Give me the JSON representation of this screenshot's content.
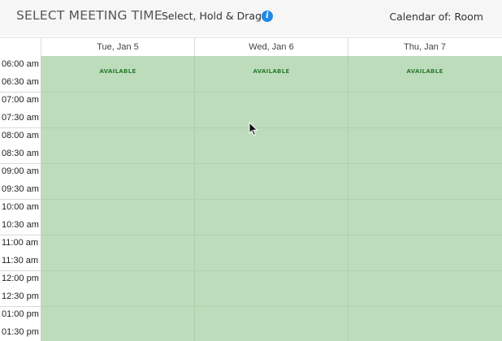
{
  "header": {
    "title": "SELECT MEETING TIME",
    "subtitle": "Select, Hold & Drag",
    "info_icon": "info-icon",
    "calendar_of": "Calendar of: Room"
  },
  "days": [
    "Tue, Jan 5",
    "Wed, Jan 6",
    "Thu, Jan 7"
  ],
  "times": [
    "06:00 am",
    "06:30 am",
    "07:00 am",
    "07:30 am",
    "08:00 am",
    "08:30 am",
    "09:00 am",
    "09:30 am",
    "10:00 am",
    "10:30 am",
    "11:00 am",
    "11:30 am",
    "12:00 pm",
    "12:30 pm",
    "01:00 pm",
    "01:30 pm"
  ],
  "availability_label": "AVAILABLE",
  "colors": {
    "available_fill": "#bcdcbc",
    "available_text": "#2e7d32",
    "info_icon": "#1e88e5"
  }
}
